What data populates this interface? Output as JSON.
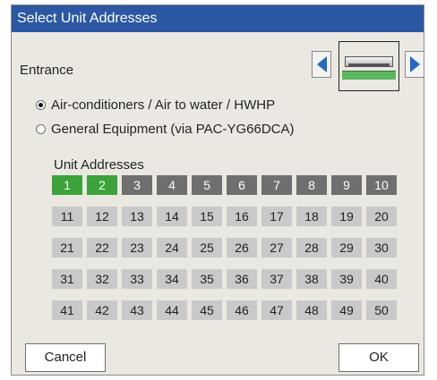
{
  "dialog": {
    "title": "Select Unit Addresses"
  },
  "entrance": {
    "label": "Entrance"
  },
  "equipment_type": {
    "options": [
      {
        "label": "Air-conditioners / Air to water / HWHP",
        "checked": true
      },
      {
        "label": "General Equipment (via PAC-YG66DCA)",
        "checked": false
      }
    ]
  },
  "unit_addresses": {
    "label": "Unit Addresses",
    "selected": [
      1,
      2
    ],
    "registered": [
      3,
      4,
      5,
      6,
      7,
      8,
      9,
      10
    ],
    "cells": [
      "1",
      "2",
      "3",
      "4",
      "5",
      "6",
      "7",
      "8",
      "9",
      "10",
      "11",
      "12",
      "13",
      "14",
      "15",
      "16",
      "17",
      "18",
      "19",
      "20",
      "21",
      "22",
      "23",
      "24",
      "25",
      "26",
      "27",
      "28",
      "29",
      "30",
      "31",
      "32",
      "33",
      "34",
      "35",
      "36",
      "37",
      "38",
      "39",
      "40",
      "41",
      "42",
      "43",
      "44",
      "45",
      "46",
      "47",
      "48",
      "49",
      "50"
    ]
  },
  "buttons": {
    "cancel": "Cancel",
    "ok": "OK"
  },
  "colors": {
    "titlebar": "#2b57a3",
    "selected": "#3ba33a",
    "registered": "#6f6f6f",
    "available": "#c9c9c9",
    "arrow": "#2366c6"
  }
}
